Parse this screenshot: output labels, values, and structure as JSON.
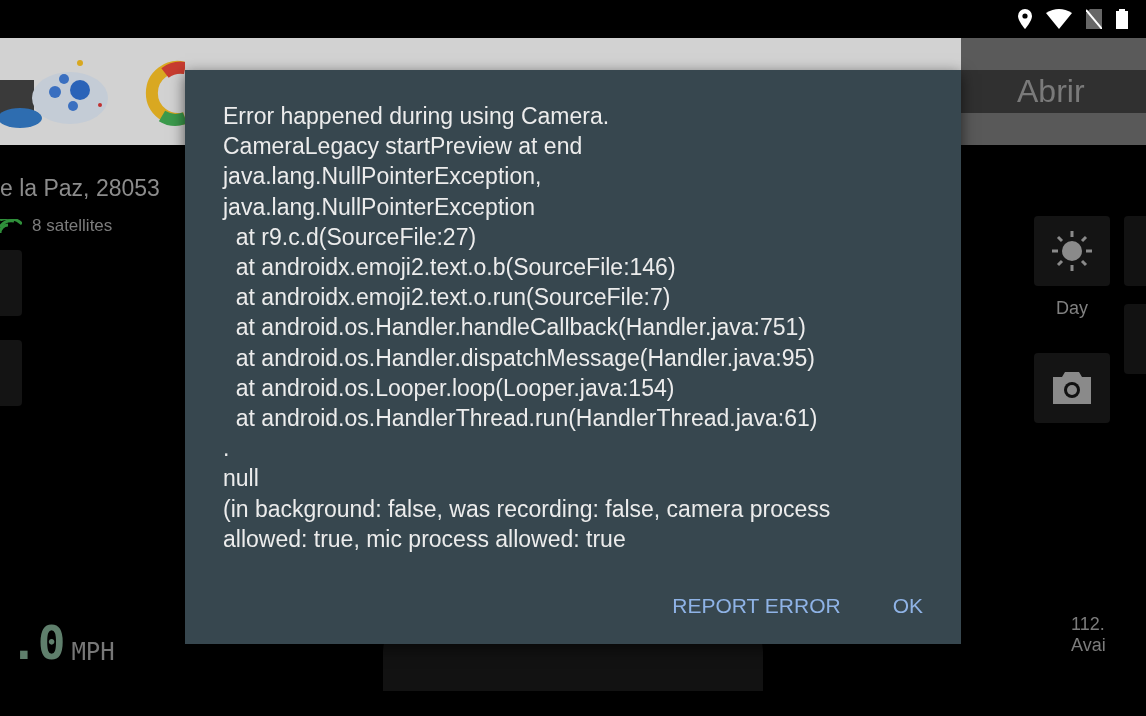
{
  "map_panel": {
    "address": "e la Paz, 28053",
    "gps": "8 satellites"
  },
  "speedometer": {
    "value": ".0",
    "unit": "MPH"
  },
  "banner": {
    "action": "Abrir"
  },
  "side_panel": {
    "mode_label": "Day",
    "storage": [
      "112.",
      "Avai"
    ]
  },
  "dialog": {
    "message": "Error happened during using Camera.\nCameraLegacy startPreview at end\njava.lang.NullPointerException,\njava.lang.NullPointerException\n  at r9.c.d(SourceFile:27)\n  at androidx.emoji2.text.o.b(SourceFile:146)\n  at androidx.emoji2.text.o.run(SourceFile:7)\n  at android.os.Handler.handleCallback(Handler.java:751)\n  at android.os.Handler.dispatchMessage(Handler.java:95)\n  at android.os.Looper.loop(Looper.java:154)\n  at android.os.HandlerThread.run(HandlerThread.java:61)\n.\nnull\n(in background: false, was recording: false, camera process\nallowed: true, mic process allowed: true",
    "buttons": [
      "REPORT ERROR",
      "OK"
    ]
  }
}
